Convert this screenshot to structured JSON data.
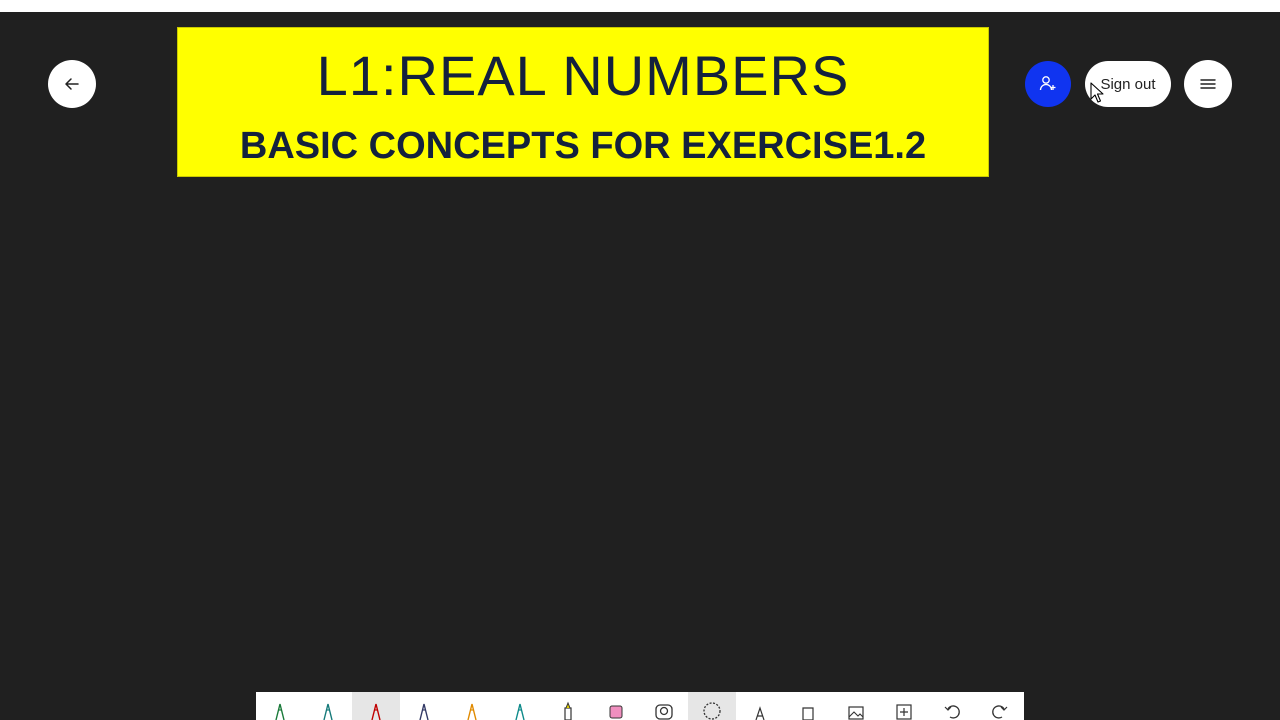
{
  "banner": {
    "title": "L1:REAL NUMBERS",
    "subtitle": "BASIC CONCEPTS FOR EXERCISE1.2"
  },
  "header": {
    "back_icon": "arrow-left-icon",
    "share_icon": "add-person-icon",
    "signout_label": "Sign out",
    "menu_icon": "hamburger-menu-icon"
  },
  "colors": {
    "background": "#202020",
    "banner_fill": "#ffff00",
    "banner_text": "#14213d",
    "share_button": "#1034f0",
    "toolbar": "#ffffff"
  },
  "toolbar": {
    "tools": [
      {
        "icon": "pen-green-icon",
        "color": "#1a7a3a",
        "active": false
      },
      {
        "icon": "pen-teal-icon",
        "color": "#167a7a",
        "active": false
      },
      {
        "icon": "pen-red-icon",
        "color": "#c00000",
        "active": true
      },
      {
        "icon": "pen-navy-icon",
        "color": "#333a66",
        "active": false
      },
      {
        "icon": "pen-orange-icon",
        "color": "#e08a00",
        "active": false
      },
      {
        "icon": "pen-cyan-icon",
        "color": "#0e8a8a",
        "active": false
      },
      {
        "icon": "highlighter-icon",
        "color": "#e5d100",
        "active": false
      },
      {
        "icon": "eraser-icon",
        "color": "#f08fbf",
        "active": false
      },
      {
        "icon": "camera-icon",
        "color": "#333333",
        "active": false
      },
      {
        "icon": "lasso-icon",
        "color": "#333333",
        "active": true
      },
      {
        "icon": "text-tool-icon",
        "color": "#333333",
        "active": false
      },
      {
        "icon": "shape-tool-icon",
        "color": "#333333",
        "active": false
      },
      {
        "icon": "image-icon",
        "color": "#333333",
        "active": false
      },
      {
        "icon": "add-page-icon",
        "color": "#333333",
        "active": false
      },
      {
        "icon": "undo-icon",
        "color": "#333333",
        "active": false
      },
      {
        "icon": "redo-icon",
        "color": "#333333",
        "active": false
      }
    ]
  }
}
